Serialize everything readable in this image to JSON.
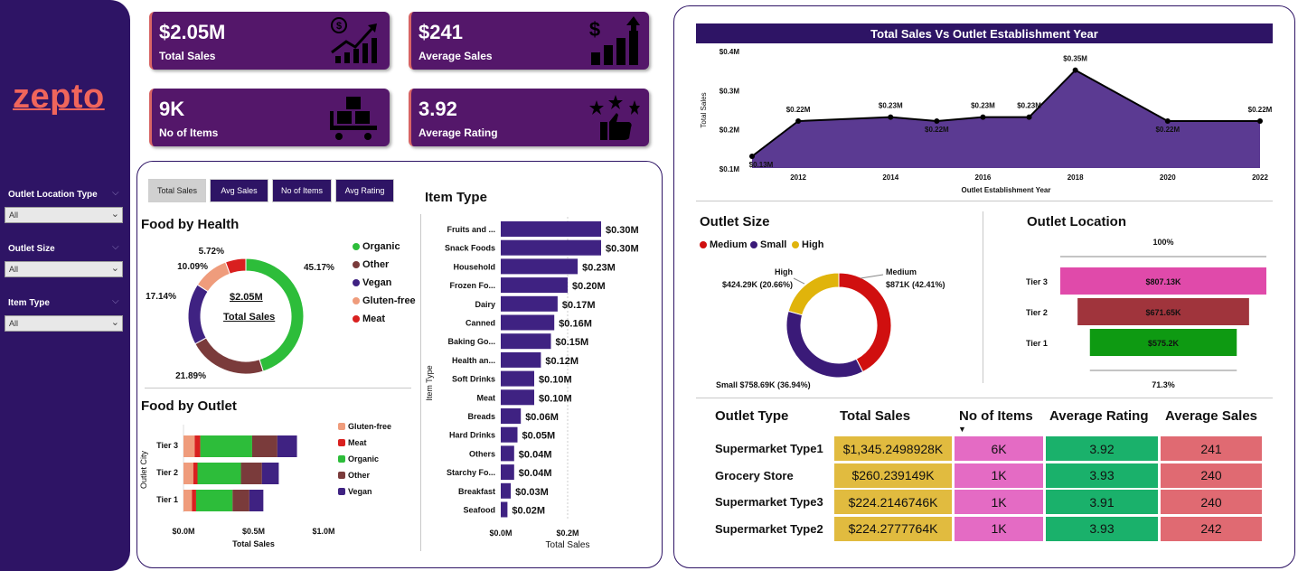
{
  "sidebar": {
    "logo": "zepto",
    "filters": [
      {
        "label": "Outlet Location Type",
        "value": "All"
      },
      {
        "label": "Outlet Size",
        "value": "All"
      },
      {
        "label": "Item Type",
        "value": "All"
      }
    ]
  },
  "kpis": [
    {
      "value": "$2.05M",
      "label": "Total Sales",
      "icon": "dollar-growth-chart-icon"
    },
    {
      "value": "$241",
      "label": "Average Sales",
      "icon": "dollar-bar-chart-icon"
    },
    {
      "value": "9K",
      "label": "No of Items",
      "icon": "boxes-cart-icon"
    },
    {
      "value": "3.92",
      "label": "Average Rating",
      "icon": "stars-thumbs-up-icon"
    }
  ],
  "tabs": [
    "Total Sales",
    "Avg Sales",
    "No of Items",
    "Avg Rating"
  ],
  "food_by_health": {
    "title": "Food by Health",
    "center_value": "$2.05M",
    "center_label": "Total Sales",
    "chart_data": {
      "type": "pie",
      "slices": [
        {
          "name": "Organic",
          "pct_label": "45.17%",
          "value": 45.17,
          "color": "#2dbd3a"
        },
        {
          "name": "Other",
          "pct_label": "21.89%",
          "value": 21.89,
          "color": "#7a3b3b"
        },
        {
          "name": "Vegan",
          "pct_label": "17.14%",
          "value": 17.14,
          "color": "#3f2282"
        },
        {
          "name": "Gluten-free",
          "pct_label": "10.09%",
          "value": 10.09,
          "color": "#ef9c7c"
        },
        {
          "name": "Meat",
          "pct_label": "5.72%",
          "value": 5.72,
          "color": "#d9201f"
        }
      ]
    }
  },
  "food_by_outlet": {
    "title": "Food by Outlet",
    "ylabel": "Outlet City",
    "xlabel": "Total Sales",
    "xticks": [
      "$0.0M",
      "$0.5M",
      "$1.0M"
    ],
    "legend": [
      "Gluten-free",
      "Meat",
      "Organic",
      "Other",
      "Vegan"
    ],
    "chart_data": {
      "type": "bar",
      "orientation": "horizontal-stacked",
      "categories": [
        "Tier 3",
        "Tier 2",
        "Tier 1"
      ],
      "xlim": [
        0,
        1.0
      ],
      "series": [
        {
          "name": "Gluten-free",
          "color": "#ef9c7c",
          "values": [
            0.08,
            0.07,
            0.06
          ]
        },
        {
          "name": "Meat",
          "color": "#d9201f",
          "values": [
            0.04,
            0.03,
            0.03
          ]
        },
        {
          "name": "Organic",
          "color": "#2dbd3a",
          "values": [
            0.37,
            0.31,
            0.26
          ]
        },
        {
          "name": "Other",
          "color": "#7a3b3b",
          "values": [
            0.18,
            0.15,
            0.12
          ]
        },
        {
          "name": "Vegan",
          "color": "#3f2282",
          "values": [
            0.14,
            0.12,
            0.1
          ]
        }
      ]
    }
  },
  "item_type": {
    "title": "Item Type",
    "ylabel": "Item Type",
    "xlabel": "Total Sales",
    "xticks": [
      "$0.0M",
      "$0.2M"
    ],
    "chart_data": {
      "type": "bar",
      "orientation": "horizontal",
      "xlim": [
        0,
        0.32
      ],
      "categories": [
        "Fruits and ...",
        "Snack Foods",
        "Household",
        "Frozen Fo...",
        "Dairy",
        "Canned",
        "Baking Go...",
        "Health an...",
        "Soft Drinks",
        "Meat",
        "Breads",
        "Hard Drinks",
        "Others",
        "Starchy Fo...",
        "Breakfast",
        "Seafood"
      ],
      "values": [
        0.3,
        0.3,
        0.23,
        0.2,
        0.17,
        0.16,
        0.15,
        0.12,
        0.1,
        0.1,
        0.06,
        0.05,
        0.04,
        0.04,
        0.03,
        0.02
      ],
      "labels": [
        "$0.30M",
        "$0.30M",
        "$0.23M",
        "$0.20M",
        "$0.17M",
        "$0.16M",
        "$0.15M",
        "$0.12M",
        "$0.10M",
        "$0.10M",
        "$0.06M",
        "$0.05M",
        "$0.04M",
        "$0.04M",
        "$0.03M",
        "$0.02M"
      ]
    }
  },
  "establishment": {
    "title": "Total Sales Vs Outlet Establishment Year",
    "ylabel": "Total Sales",
    "xlabel": "Outlet Establishment Year",
    "yticks": [
      "$0.4M",
      "$0.3M",
      "$0.2M",
      "$0.1M"
    ],
    "xticks": [
      "2012",
      "2014",
      "2016",
      "2018",
      "2020",
      "2022"
    ],
    "chart_data": {
      "type": "area",
      "x": [
        2011,
        2012,
        2014,
        2015,
        2016,
        2017,
        2018,
        2020,
        2022
      ],
      "y": [
        0.13,
        0.22,
        0.23,
        0.22,
        0.23,
        0.23,
        0.35,
        0.22,
        0.22
      ],
      "labels": [
        "$0.13M",
        "$0.22M",
        "$0.23M",
        "$0.22M",
        "$0.23M",
        "$0.23M",
        "$0.35M",
        "$0.22M",
        "$0.22M"
      ],
      "ylim": [
        0.1,
        0.4
      ],
      "xlim": [
        2011,
        2022
      ]
    }
  },
  "outlet_size": {
    "title": "Outlet Size",
    "legend": [
      "Medium",
      "Small",
      "High"
    ],
    "chart_data": {
      "type": "pie",
      "slices": [
        {
          "name": "Medium",
          "label": "$871K (42.41%)",
          "value": 42.41,
          "color": "#d00f0f"
        },
        {
          "name": "Small",
          "label": "Small $758.69K (36.94%)",
          "value": 36.94,
          "color": "#3a1a78"
        },
        {
          "name": "High",
          "label": "$424.29K (20.66%)",
          "value": 20.66,
          "color": "#e0b40b"
        }
      ]
    }
  },
  "outlet_location": {
    "title": "Outlet Location",
    "top_pct": "100%",
    "bottom_pct": "71.3%",
    "chart_data": {
      "type": "bar",
      "orientation": "funnel",
      "categories": [
        "Tier 3",
        "Tier 2",
        "Tier 1"
      ],
      "values": [
        807.13,
        671.65,
        575.2
      ],
      "labels": [
        "$807.13K",
        "$671.65K",
        "$575.2K"
      ],
      "colors": [
        "#e04aaa",
        "#a0343c",
        "#0e9a12"
      ]
    }
  },
  "outlet_table": {
    "headers": [
      "Outlet Type",
      "Total Sales",
      "No of Items",
      "Average Rating",
      "Average Sales"
    ],
    "rows": [
      {
        "type": "Supermarket Type1",
        "sales": "$1,345.2498928K",
        "items": "6K",
        "rating": "3.92",
        "avg": "241"
      },
      {
        "type": "Grocery Store",
        "sales": "$260.239149K",
        "items": "1K",
        "rating": "3.93",
        "avg": "240"
      },
      {
        "type": "Supermarket Type3",
        "sales": "$224.2146746K",
        "items": "1K",
        "rating": "3.91",
        "avg": "240"
      },
      {
        "type": "Supermarket Type2",
        "sales": "$224.2777764K",
        "items": "1K",
        "rating": "3.93",
        "avg": "242"
      }
    ],
    "colors": {
      "sales": "#e1bb3f",
      "items": "#e46bc4",
      "rating": "#1ab16b",
      "avg": "#e06a72"
    }
  }
}
